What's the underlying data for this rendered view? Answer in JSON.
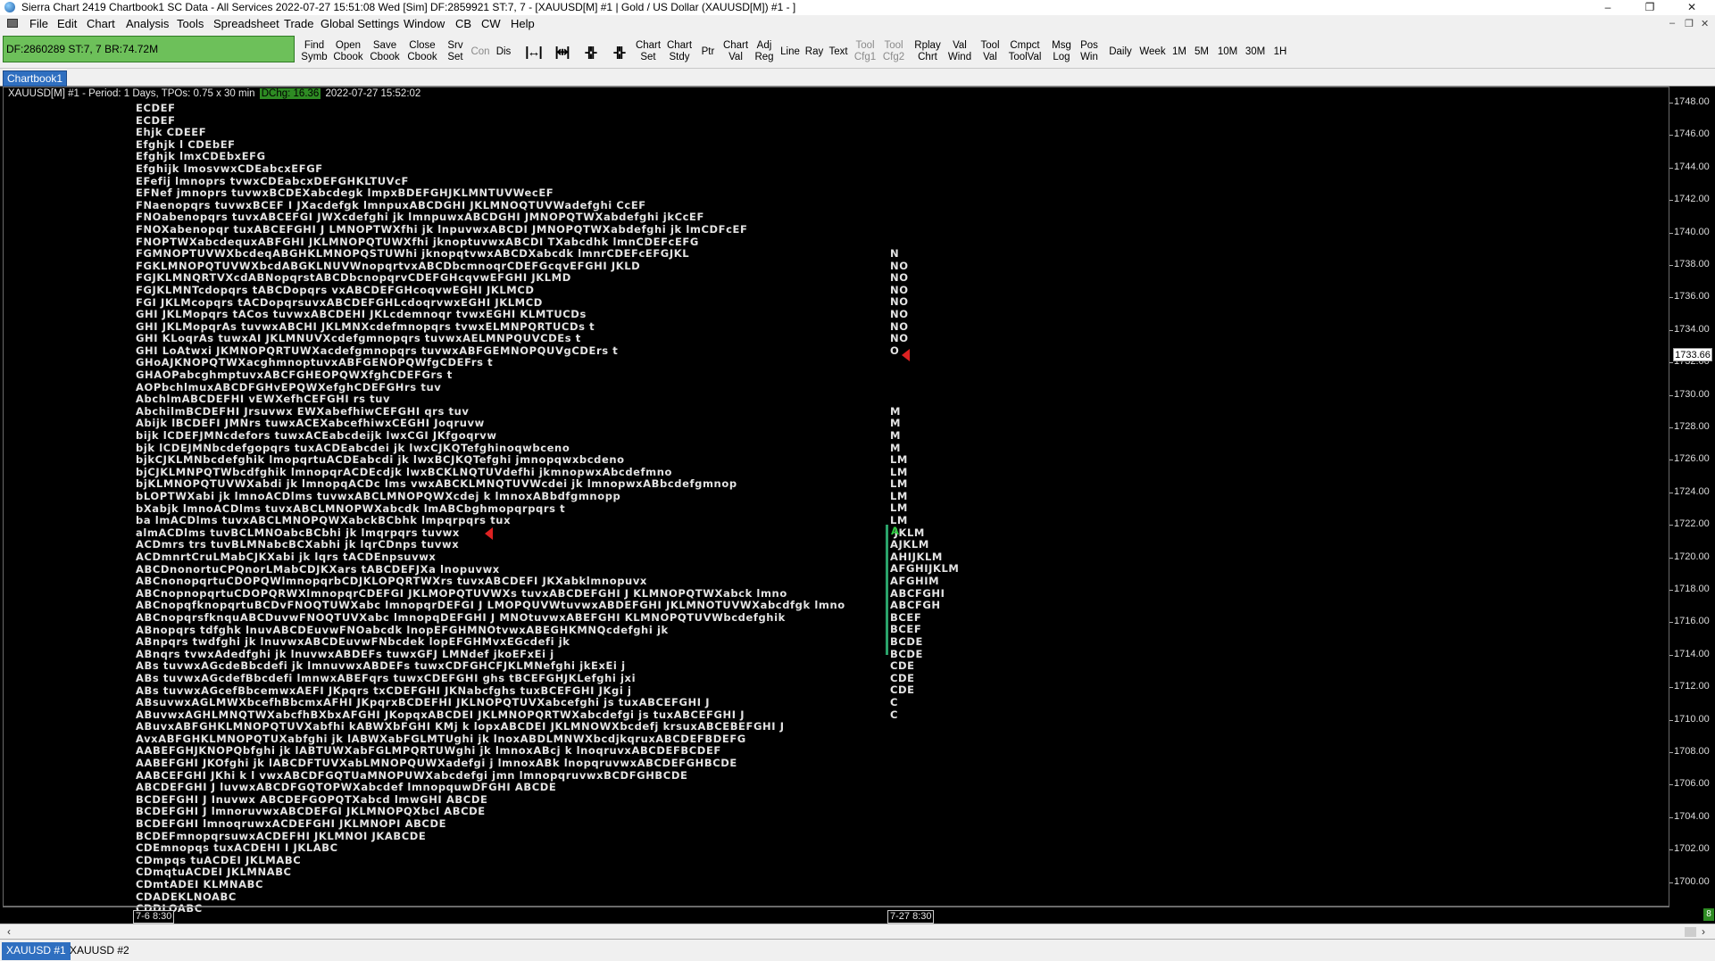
{
  "window": {
    "title": "Sierra Chart 2419 Chartbook1  SC Data - All Services 2022-07-27  15:51:08 Wed [Sim]  DF:2859921  ST:7, 7 - [XAUUSD[M]  #1 | Gold / US Dollar (XAUUSD[M])  #1 - ]",
    "minimize": "–",
    "maximize": "❐",
    "close": "✕"
  },
  "menu": {
    "items": [
      "File",
      "Edit",
      "Chart",
      "Analysis",
      "Tools",
      "Spreadsheet",
      "Trade",
      "Global Settings",
      "Window",
      "CB",
      "CW",
      "Help"
    ],
    "mdi_minimize": "–",
    "mdi_restore": "❐",
    "mdi_close": "✕"
  },
  "toolbar": {
    "status_text": "DF:2860289  ST:7, 7   BR:74.72M",
    "status_color": "#6dc05a",
    "buttons": [
      "Find\nSymb",
      "Open\nCbook",
      "Save\nCbook",
      "Close\nCbook",
      "Srv\nSet",
      "Con",
      "Dis",
      "|↔|",
      "|⇹|",
      "-|¦|-",
      "-|¦|-",
      "Chart\nSet",
      "Chart\nStdy",
      "Ptr",
      "Chart\nVal",
      "Adj\nReg",
      "Line",
      "Ray",
      "Text",
      "Tool\nCfg1",
      "Tool\nCfg2",
      "Rplay\nChrt",
      "Val\nWind",
      "Tool\nVal",
      "Cmpct\nToolVal",
      "Msg\nLog",
      "Pos\nWin",
      "Daily",
      "Week",
      "1M",
      "5M",
      "10M",
      "30M",
      "1H"
    ]
  },
  "tabs": {
    "chartbook": "Chartbook1"
  },
  "chart": {
    "header_symbol": "XAUUSD[M]  #1 - Period: 1 Days, TPOs: 0.75 x 30 min",
    "header_dchg": "DChg: 16.36",
    "header_time": "2022-07-27  15:52:02",
    "last_price": "1733.66",
    "price_ticks": [
      "1748.00",
      "1746.00",
      "1744.00",
      "1742.00",
      "1740.00",
      "1738.00",
      "1736.00",
      "1734.00",
      "1732.00",
      "1730.00",
      "1728.00",
      "1726.00",
      "1724.00",
      "1722.00",
      "1720.00",
      "1718.00",
      "1716.00",
      "1714.00",
      "1712.00",
      "1710.00",
      "1708.00",
      "1706.00",
      "1704.00",
      "1702.00",
      "1700.00"
    ],
    "time_labels": [
      "7-6  8:30",
      "7-27  8:30"
    ],
    "corner_badge": "8",
    "profile1_rows": [
      "ECDEF",
      "ECDEF",
      "Ehjk CDEEF",
      "Efghjk l CDEbEF",
      "Efghjk lmxCDEbxEFG",
      "Efghijk lmosvwxCDEabcxEFGF",
      "EFefij lmnoprs tvwxCDEabcxDEFGHKLTUVcF",
      "EFNef jmnoprs tuvwxBCDEXabcdegk lmpxBDEFGHJKLMNTUVWecEF",
      "FNaenopqrs tuvwxBCEF I JXacdefgk lmnpuxABCDGHI JKLMNOQTUVWadefghi CcEF",
      "FNOabenopqrs tuvxABCEFGI JWXcdefghi jk lmnpuwxABCDGHI JMNOPQTWXabdefghi jkCcEF",
      "FNOXabenopqr tuxABCEFGHI J LMNOPTWXfhi jk lnpuvwxABCDI JMNOPQTWXabdefghi jk lmCDFcEF",
      "FNOPTWXabcdequxABFGHI JKLMNOPQTUWXfhi jknoptuvwxABCDI TXabcdhk lmnCDEFcEFG",
      "FGMNOPTUVWXbcdeqABGHKLMNOPQSTUWhi jknopqtvwxABCDXabcdk lmnrCDEFcEFGJKL",
      "FGKLMNOPQTUVWXbcdABGKLNUVWnopqrtvxABCDbcmnoqrCDEFGcqvEFGHI JKLD",
      "FGJKLMNQRTVXcdABNopqrstABCDbcnopqrvCDEFGHcqvwEFGHI JKLMD",
      "FGJKLMNTcdopqrs tABCDopqrs vxABCDEFGHcoqvwEGHI JKLMCD",
      "FGI JKLMcopqrs tACDopqrsuvxABCDEFGHLcdoqrvwxEGHI JKLMCD",
      "GHI JKLMopqrs tACos tuvwxABCDEHI JKLcdemnoqr tvwxEGHI KLMTUCDs",
      "GHI JKLMopqrAs tuvwxABCHI JKLMNXcdefmnopqrs tvwxELMNPQRTUCDs t",
      "GHI KLoqrAs tuwxAI JKLMNUVXcdefgmnopqrs tuvwxAELMNPQUVCDEs t",
      "GHI LoAtwxi JKMNOPQRTUWXacdefgmnopqrs tuvwxABFGEMNOPQUVgCDErs t",
      "GHoAJKNOPQTWXacghmnoptuvxABFGENOPQWfgCDEFrs t",
      "GHAOPabcghmptuvxABCFGHEOPQWXfghCDEFGrs t",
      "AOPbchlmuxABCDFGHvEPQWXefghCDEFGHrs tuv",
      "AbchlmABCDEFHI vEWXefhCEFGHI rs tuv",
      "AbchilmBCDEFHI Jrsuvwx EWXabefhiwCEFGHI qrs tuv",
      "Abijk lBCDEFI JMNrs tuwxACEXabcefhiwxCEGHI Joqruvw",
      "bijk lCDEFJMNcdefors tuwxACEabcdeijk lwxCGI JKfgoqrvw",
      "bjk lCDEJMNbcdefgopqrs tuxACDEabcdei jk lwxCJKQTefghinoqwbceno",
      "bjkCJKLMNbcdefghik lmopqrtuACDEabcdi jk lwxBCJKQTefghi jmnopqwxbcdeno",
      "bjCJKLMNPQTWbcdfghik lmnopqrACDEcdjk lwxBCKLNQTUVdefhi jkmnopwxAbcdefmno",
      "bjKLMNOPQTUVWXabdi jk lmnopqACDc lms vwxABCKLMNQTUVWcdei jk lmnopwxABbcdefgmnop",
      "bLOPTWXabi jk lmnoACDlms tuvwxABCLMNOPQWXcdej k lmnoxABbdfgmnopp",
      "bXabjk lmnoACDlms tuvxABCLMNOPWXabcdk lmABCbghmopqrpqrs t",
      "ba lmACDlms tuvxABCLMNOPQWXabckBCbhk lmpqrpqrs tux",
      "almACDlms tuvBCLMNOabcBCbhi jk lmqrpqrs tuvwx",
      "ACDmrs trs tuvBLMNabcBCXabhi jk lqrCDnps tuvwx",
      "ACDmnrtCruLMabCJKXabi jk lqrs tACDEnpsuvwx",
      "ABCDnonortuCPQnorLMabCDJKXars tABCDEFJXa lnopuvwx",
      "ABCnonopqrtuCDOPQWlmnopqrbCDJKLOPQRTWXrs tuvxABCDEFI JKXabklmnopuvx",
      "ABCnopnopqrtuCDOPQRWXlmnopqrCDEFGI JKLMOPQTUVWXs tuvxABCDEFGHI J KLMNOPQTWXabck lmno",
      "ABCnopqfknopqrtuBCDvFNOQTUWXabc lmnopqrDEFGI J LMOPQUVWtuvwxABDEFGHI JKLMNOTUVWXabcdfgk lmno",
      "ABCnopqrsfknquABCDuvwFNOQTUVXabc lmnopqDEFGHI J MNOtuvwxABEFGHI KLMNOPQTUVWbcdefghik",
      "ABnopqrs tdfghk lnuvABCDEuvwFNOabcdk lnopEFGHMNOtvwxABEGHKMNQcdefghi jk",
      "ABnpqrs twdfghi jk lnuvwxABCDEuvwFNbcdek lopEFGHMvxEGcdefi jk",
      "ABnqrs tvwxAdedfghi jk lnuvwxABDEFs tuwxGFJ LMNdef jkoEFxEi j",
      "ABs tuvwxAGcdeBbcdefi jk lmnuvwxABDEFs tuwxCDFGHCFJKLMNefghi jkExEi j",
      "ABs tuvwxAGcdefBbcdefi lmnwxABEFqrs tuwxCDEFGHI ghs tBCEFGHJKLefghi jxi",
      "ABs tuvwxAGcefBbcemwxAEFI JKpqrs txCDEFGHI JKNabcfghs tuxBCEFGHI JKgi j",
      "ABsuvwxAGLMWXbcefhBbcmxAFHI JKpqrxBCDEFHI JKLNOPQTUVXabcefghi js tuxABCEFGHI J",
      "ABuvwxAGHLMNQTWXabcfhBXbxAFGHI JKopqxABCDEI JKLMNOPQRTWXabcdefgi js tuxABCEFGHI J",
      "ABuvxABFGHKLMNOPQTUVXabfhi kABWXbFGHI KMj k lopxABCDEI JKLMNOWXbcdefj krsuxABCEBEFGHI J",
      "AvxABFGHKLMNOPQTUXabfghi jk lABWXabFGLMTUghi jk lnoxABDLMNWXbcdjkqruxABCDEFBDEFG",
      "AABEFGHJKNOPQbfghi jk lABTUWXabFGLMPQRTUWghi jk lmnoxABcj k lnoqruvxABCDEFBCDEF",
      "AABEFGHI JKOfghi jk lABCDFTUVXabLMNOPQUWXadefgi j lmnoxABk lnopqruvwxABCDEFGHBCDE",
      "AABCEFGHI JKhi k l vwxABCDFGQTUaMNOPUWXabcdefgi jmn lmnopqruvwxBCDFGHBCDE",
      "ABCDEFGHI J luvwxABCDFGQTOPWXabcdef lmnopquwDFGHI ABCDE",
      "BCDEFGHI J Inuvwx ABCDEFGOPQTXabcd lmwGHI ABCDE",
      "BCDEFGHI J lmnoruvwxABCDEFGI JKLMNOPQXbcl ABCDE",
      "BCDEFGHI lmnoqruwxACDEFGHI JKLMNOPI ABCDE",
      "BCDEFmnopqrsuwxACDEFHI JKLMNOI JKABCDE",
      "CDEmnopqs tuxACDEHI I JKLABC",
      "CDmpqs tuACDEI JKLMABC",
      "CDmqtuACDEI JKLMNABC",
      "CDmtADEI KLMNABC",
      "CDADEKLNOABC",
      "CDDLOABC"
    ],
    "profile2_rows": [
      "N",
      "NO",
      "NO",
      "NO",
      "NO",
      "NO",
      "NO",
      "NO",
      "O",
      "",
      "",
      "",
      "",
      "M",
      "M",
      "M",
      "M",
      "LM",
      "LM",
      "LM",
      "LM",
      "LM",
      "LM",
      " JKLM",
      "AJKLM",
      "AHIJKLM",
      "AFGHIJKLM",
      "AFGHIM",
      "ABCFGHI",
      "ABCFGH",
      "BCEF",
      "BCEF",
      "BCDE",
      "BCDE",
      "CDE",
      "CDE",
      "CDE",
      "C",
      "C"
    ],
    "ib_letter": "A",
    "poc_color": "#dd2222",
    "ib_color": "#2aa36a"
  },
  "bottom_tabs": [
    "XAUUSD  #1",
    "XAUUSD  #2"
  ]
}
